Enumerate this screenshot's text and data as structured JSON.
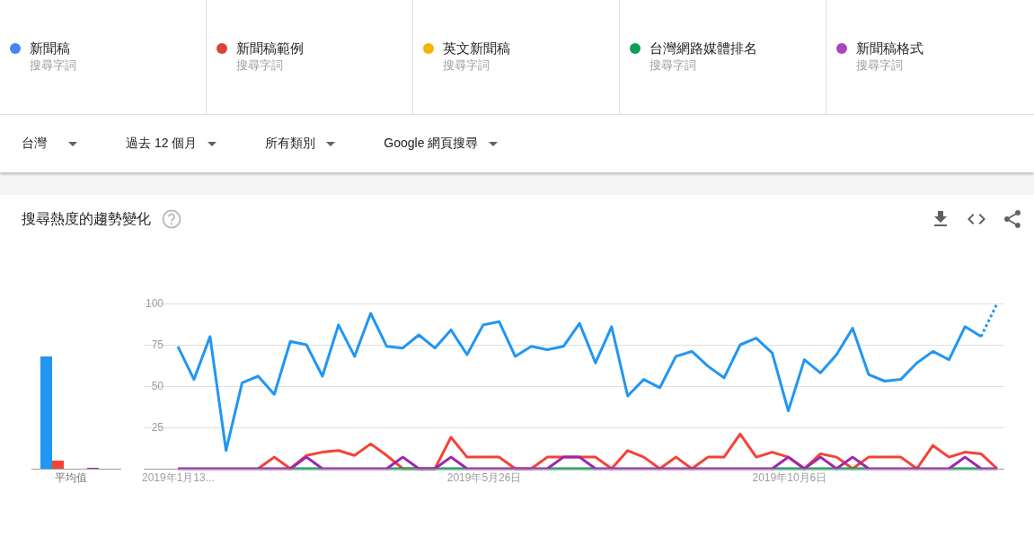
{
  "terms": [
    {
      "name": "新聞稿",
      "type": "搜尋字詞",
      "color": "#4285f4"
    },
    {
      "name": "新聞稿範例",
      "type": "搜尋字詞",
      "color": "#db4437"
    },
    {
      "name": "英文新聞稿",
      "type": "搜尋字詞",
      "color": "#f4b400"
    },
    {
      "name": "台灣網路媒體排名",
      "type": "搜尋字詞",
      "color": "#0f9d58"
    },
    {
      "name": "新聞稿格式",
      "type": "搜尋字詞",
      "color": "#ab47bc"
    }
  ],
  "filters": [
    {
      "label": "台灣"
    },
    {
      "label": "過去 12 個月"
    },
    {
      "label": "所有類別"
    },
    {
      "label": "Google 網頁搜尋"
    }
  ],
  "interest_over_time": {
    "title": "搜尋熱度的趨勢變化",
    "average_label": "平均值",
    "chart_data": {
      "type": "line",
      "ylim": [
        0,
        100
      ],
      "yticks": [
        25,
        50,
        75,
        100
      ],
      "categories": [
        "2019年1月13...",
        null,
        null,
        null,
        null,
        null,
        null,
        null,
        null,
        null,
        null,
        null,
        null,
        null,
        null,
        null,
        null,
        null,
        null,
        "2019年5月26日",
        null,
        null,
        null,
        null,
        null,
        null,
        null,
        null,
        null,
        null,
        null,
        null,
        null,
        null,
        null,
        null,
        null,
        null,
        "2019年10月6日",
        null,
        null,
        null,
        null,
        null,
        null,
        null,
        null,
        null,
        null,
        null,
        null,
        null
      ],
      "series": [
        {
          "color": "#2196f3",
          "values": [
            74,
            54,
            80,
            11,
            52,
            56,
            45,
            77,
            75,
            56,
            87,
            68,
            94,
            74,
            73,
            81,
            73,
            84,
            69,
            87,
            89,
            68,
            74,
            72,
            74,
            88,
            64,
            86,
            44,
            54,
            49,
            68,
            71,
            62,
            55,
            75,
            79,
            70,
            35,
            66,
            58,
            69,
            85,
            57,
            53,
            54,
            64,
            71,
            66,
            86,
            80,
            null
          ]
        },
        {
          "color": "#2196f3",
          "line_style": "dotted",
          "values": [
            null,
            null,
            null,
            null,
            null,
            null,
            null,
            null,
            null,
            null,
            null,
            null,
            null,
            null,
            null,
            null,
            null,
            null,
            null,
            null,
            null,
            null,
            null,
            null,
            null,
            null,
            null,
            null,
            null,
            null,
            null,
            null,
            null,
            null,
            null,
            null,
            null,
            null,
            null,
            null,
            null,
            null,
            null,
            null,
            null,
            null,
            null,
            null,
            null,
            null,
            80,
            100
          ]
        },
        {
          "color": "#f44336",
          "values": [
            null,
            null,
            null,
            null,
            null,
            0,
            7,
            0,
            8,
            10,
            11,
            8,
            15,
            8,
            0,
            0,
            0,
            19,
            7,
            7,
            7,
            0,
            0,
            7,
            7,
            7,
            7,
            0,
            11,
            7,
            0,
            7,
            0,
            7,
            7,
            21,
            7,
            10,
            7,
            0,
            9,
            7,
            0,
            7,
            7,
            7,
            0,
            14,
            7,
            10,
            9,
            0
          ]
        },
        {
          "color": "#109d58",
          "values": [
            null,
            null,
            null,
            null,
            null,
            null,
            null,
            0,
            0,
            0,
            null,
            null,
            null,
            0,
            0,
            0,
            0,
            0,
            0,
            null,
            null,
            null,
            null,
            0,
            0,
            0,
            0,
            null,
            null,
            null,
            null,
            null,
            null,
            null,
            null,
            null,
            null,
            0,
            0,
            0,
            0,
            0,
            0,
            0,
            null,
            null,
            null,
            null,
            0,
            0,
            0,
            null
          ]
        },
        {
          "color": "#9c27b0",
          "values": [
            0,
            0,
            0,
            0,
            0,
            0,
            0,
            0,
            7,
            0,
            0,
            0,
            0,
            0,
            7,
            0,
            0,
            7,
            0,
            0,
            0,
            0,
            0,
            0,
            7,
            7,
            0,
            0,
            0,
            0,
            0,
            0,
            0,
            0,
            0,
            0,
            0,
            0,
            7,
            0,
            7,
            0,
            7,
            0,
            0,
            0,
            0,
            0,
            0,
            7,
            0,
            0
          ]
        }
      ],
      "grid": true
    }
  }
}
